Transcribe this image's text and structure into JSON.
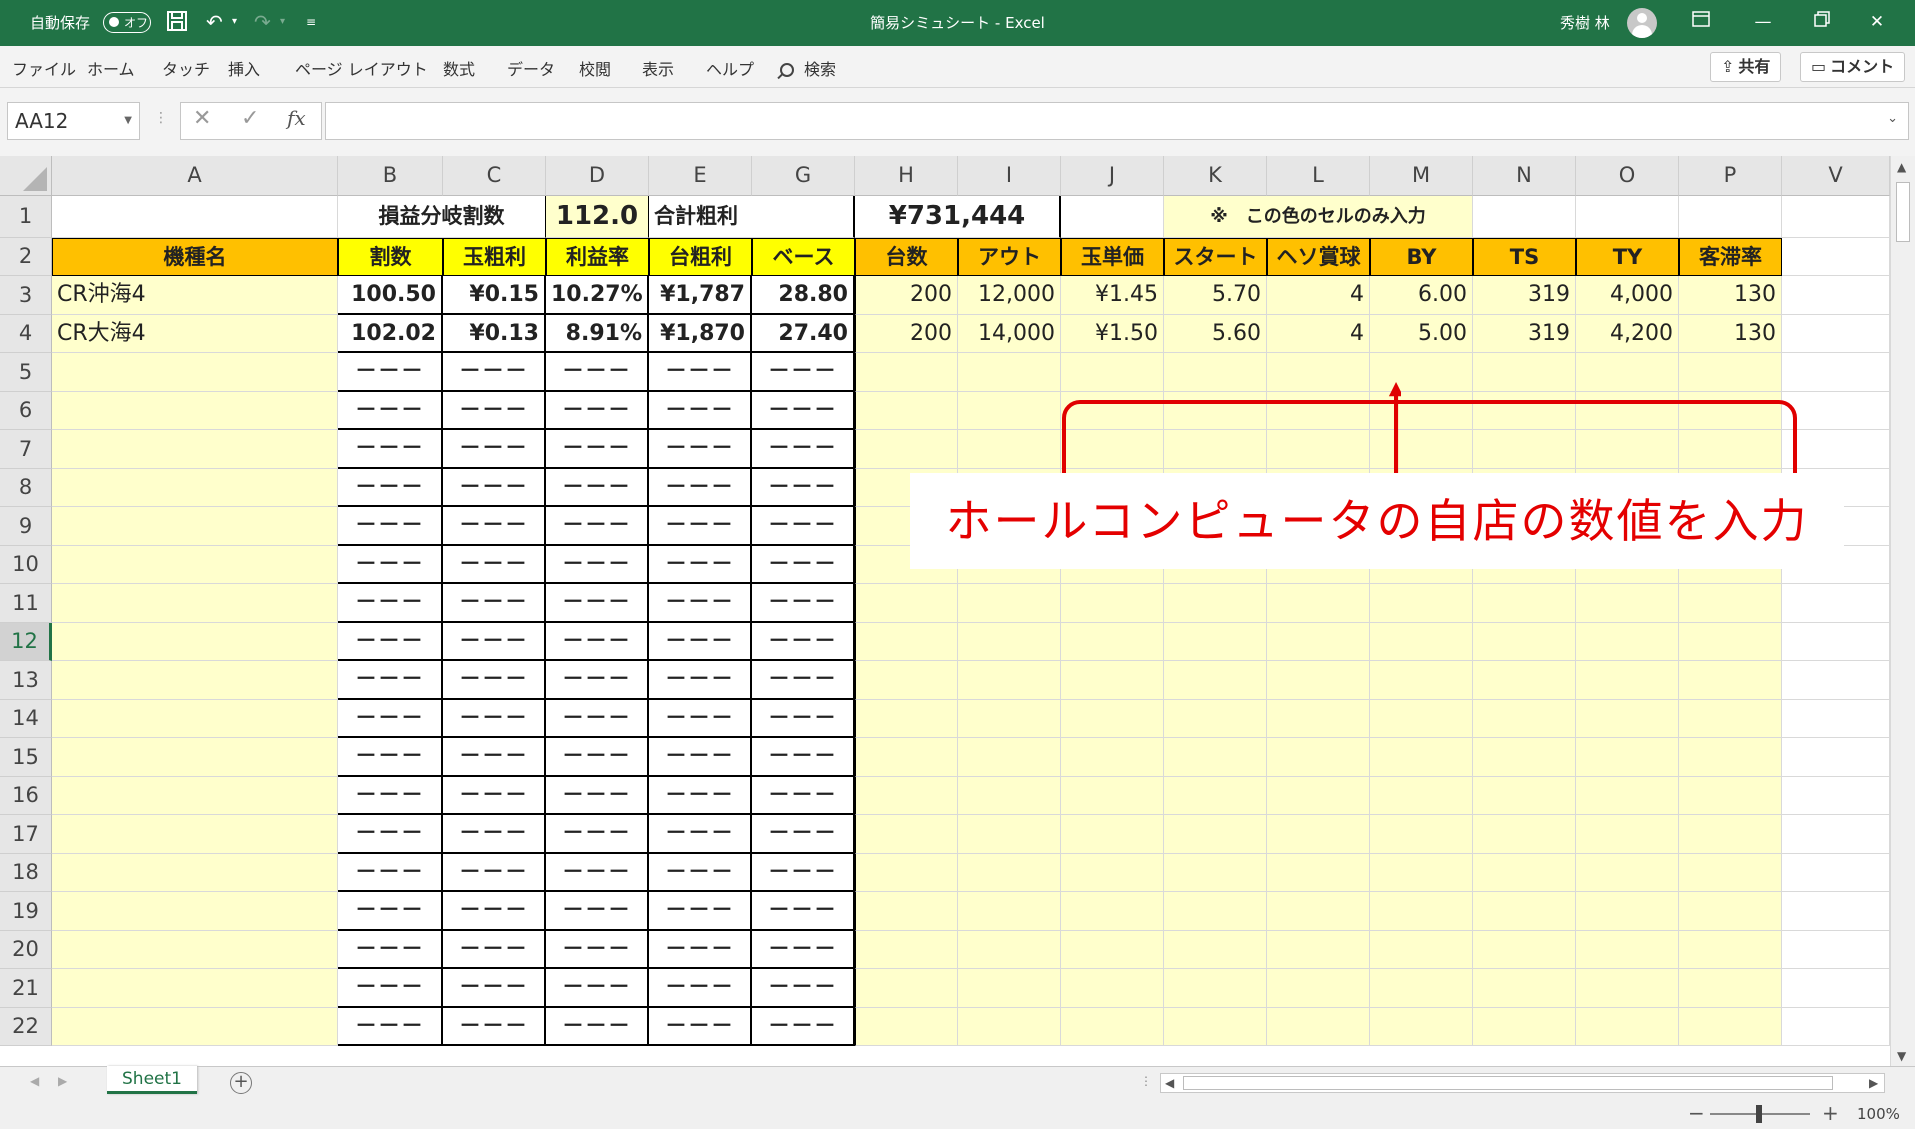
{
  "titlebar": {
    "autosave_label": "自動保存",
    "autosave_state": "オフ",
    "title": "簡易シミュシート  -  Excel",
    "user_name": "秀樹 林"
  },
  "menu": {
    "items": [
      "ファイル",
      "ホーム",
      "タッチ",
      "挿入",
      "ページ レイアウト",
      "数式",
      "データ",
      "校閲",
      "表示",
      "ヘルプ"
    ],
    "search_label": "検索",
    "share_label": "共有",
    "comment_label": "コメント"
  },
  "formula_bar": {
    "name_box": "AA12",
    "fx": "fx",
    "formula": ""
  },
  "sheet": {
    "columns": [
      "A",
      "B",
      "C",
      "D",
      "E",
      "G",
      "H",
      "I",
      "J",
      "K",
      "L",
      "M",
      "N",
      "O",
      "P",
      "V"
    ],
    "row_numbers": [
      "1",
      "2",
      "3",
      "4",
      "5",
      "6",
      "7",
      "8",
      "9",
      "10",
      "11",
      "12",
      "13",
      "14",
      "15",
      "16",
      "17",
      "18",
      "19",
      "20",
      "21",
      "22"
    ],
    "active_row": "12",
    "row1": {
      "breakeven_label": "損益分岐割数",
      "breakeven_value": "112.0",
      "total_profit_label": "合計粗利",
      "total_profit_value": "¥731,444",
      "note": "※　この色のセルのみ入力"
    },
    "headers": [
      "機種名",
      "割数",
      "玉粗利",
      "利益率",
      "台粗利",
      "ベース",
      "台数",
      "アウト",
      "玉単価",
      "スタート",
      "ヘソ賞球",
      "BY",
      "TS",
      "TY",
      "客滞率"
    ],
    "rows": [
      [
        "CR沖海4",
        "100.50",
        "¥0.15",
        "10.27%",
        "¥1,787",
        "28.80",
        "200",
        "12,000",
        "¥1.45",
        "5.70",
        "4",
        "6.00",
        "319",
        "4,000",
        "130"
      ],
      [
        "CR大海4",
        "102.02",
        "¥0.13",
        "8.91%",
        "¥1,870",
        "27.40",
        "200",
        "14,000",
        "¥1.50",
        "5.60",
        "4",
        "5.00",
        "319",
        "4,200",
        "130"
      ]
    ],
    "empty_calc": "－－－"
  },
  "annotation": {
    "callout": "ホールコンピュータの自店の数値を入力",
    "color": "#e40000"
  },
  "tabs": {
    "sheet_name": "Sheet1",
    "add_symbol": "+"
  },
  "status": {
    "zoom": "100%"
  }
}
